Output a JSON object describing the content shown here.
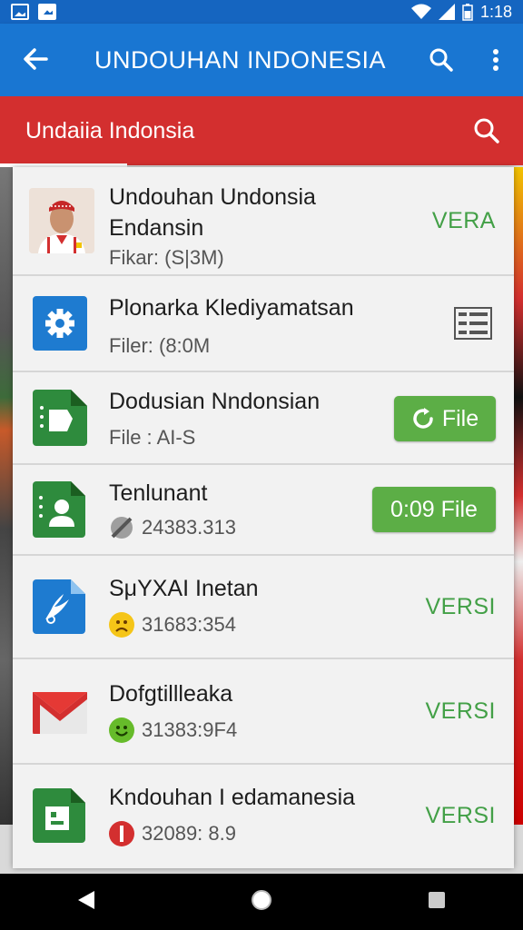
{
  "status_bar": {
    "time": "1:18"
  },
  "app_bar": {
    "title": "UNDOUHAN INDONESIA",
    "back_icon": "arrow-left-icon",
    "search_icon": "search-icon",
    "menu_icon": "more-vert-icon"
  },
  "search_bar": {
    "text": "Undaiia Indonsia",
    "icon": "search-icon"
  },
  "items": [
    {
      "title": "Undouhan Undonsia",
      "title2": "Endansin",
      "subtitle": "Fikar: (S|3M)",
      "action": "VERA"
    },
    {
      "title": "Plonarka Klediyamatsan",
      "subtitle": "Filer: (8:0M",
      "action": ""
    },
    {
      "title": "Dodusian Nndonsian",
      "subtitle": "File : AI-S",
      "action": "File"
    },
    {
      "title": "Tenlunant",
      "subtitle": "24383.313",
      "action": "0:09 File"
    },
    {
      "title": "SμΥXAI Inetan",
      "subtitle": "31683:354",
      "action": "VERSI"
    },
    {
      "title": "Dofgtillleaka",
      "subtitle": "31383:9F4",
      "action": "VERSI"
    },
    {
      "title": "Kndouhan I edamanesia",
      "subtitle": "32089: 8.9",
      "action": "VERSI"
    }
  ],
  "colors": {
    "blue_dark": "#1565c0",
    "blue": "#1976d2",
    "red": "#d32f2f",
    "green": "#43a047",
    "green_button": "#5cae46"
  }
}
